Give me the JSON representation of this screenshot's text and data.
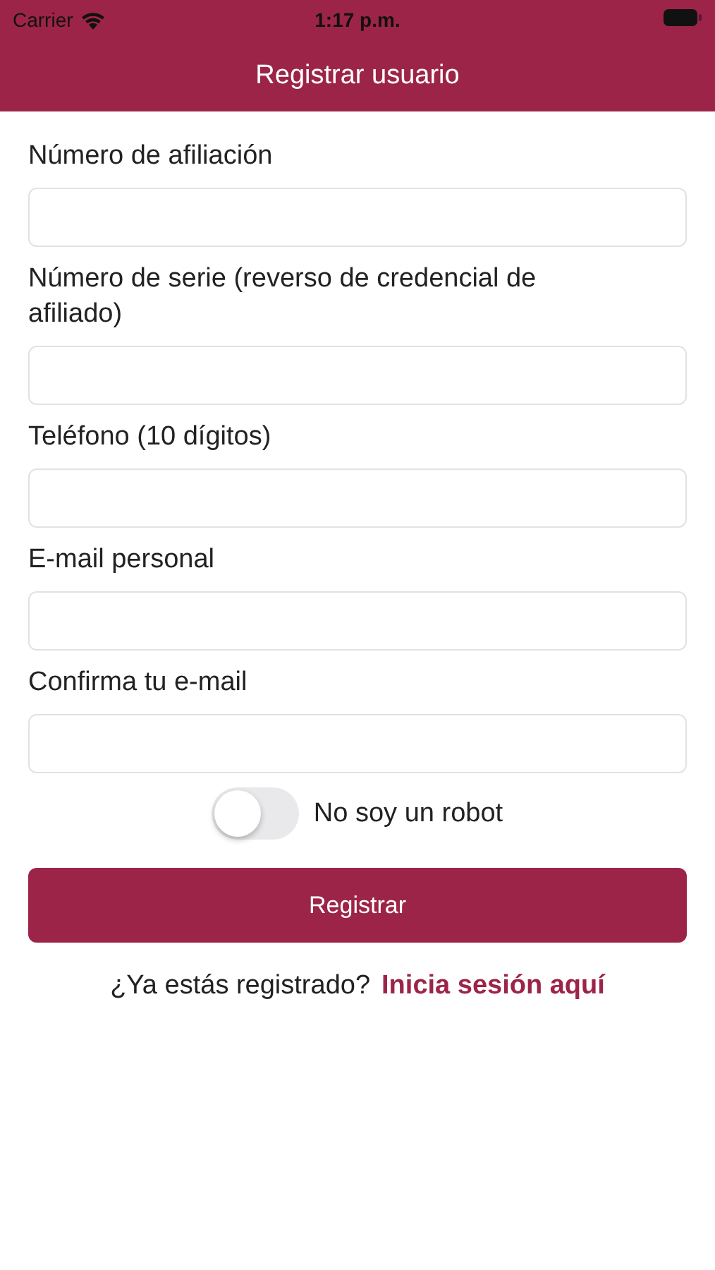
{
  "status_bar": {
    "carrier": "Carrier",
    "time": "1:17 p.m."
  },
  "nav_bar": {
    "title": "Registrar usuario"
  },
  "fields": [
    {
      "label": "Número de afiliación"
    },
    {
      "label": "Número de serie (reverso de credencial de afiliado)"
    },
    {
      "label": "Teléfono (10 dígitos)"
    },
    {
      "label": "E-mail personal"
    },
    {
      "label": "Confirma tu e-mail"
    }
  ],
  "robot_toggle": {
    "label": "No soy un robot",
    "on": false
  },
  "submit_button": "Registrar",
  "login_prompt": {
    "text": "¿Ya estás registrado?",
    "link": "Inicia sesión aquí"
  }
}
